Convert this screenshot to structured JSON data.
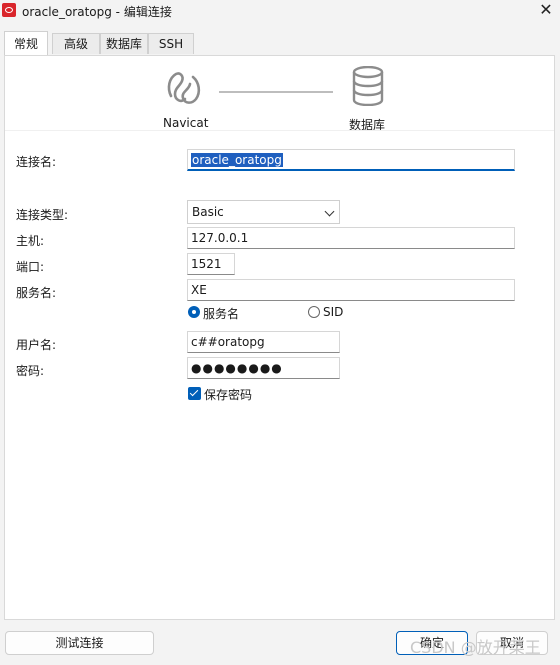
{
  "window": {
    "title": "oracle_oratopg - 编辑连接",
    "close_glyph": "✕",
    "app_icon": "oracle-icon"
  },
  "tabs": [
    {
      "label": "常规",
      "active": true
    },
    {
      "label": "高级",
      "active": false
    },
    {
      "label": "数据库",
      "active": false
    },
    {
      "label": "SSH",
      "active": false
    }
  ],
  "banner": {
    "left_label": "Navicat",
    "right_label": "数据库",
    "left_icon": "navicat-icon",
    "right_icon": "database-icon"
  },
  "form": {
    "connection_name": {
      "label": "连接名:",
      "value": "oracle_oratopg"
    },
    "connection_type": {
      "label": "连接类型:",
      "value": "Basic"
    },
    "host": {
      "label": "主机:",
      "value": "127.0.0.1"
    },
    "port": {
      "label": "端口:",
      "value": "1521"
    },
    "service_name": {
      "label": "服务名:",
      "value": "XE"
    },
    "service_type_options": [
      {
        "label": "服务名",
        "selected": true
      },
      {
        "label": "SID",
        "selected": false
      }
    ],
    "username": {
      "label": "用户名:",
      "value": "c##oratopg"
    },
    "password": {
      "label": "密码:",
      "value": "●●●●●●●●"
    },
    "save_password": {
      "label": "保存密码",
      "checked": true
    }
  },
  "footer": {
    "test_connection_label": "测试连接",
    "ok_label": "确定",
    "cancel_label": "取消"
  },
  "watermark": "CSDN @放开菜王",
  "colors": {
    "accent": "#005fb8",
    "oracle_red": "#d9252b"
  }
}
